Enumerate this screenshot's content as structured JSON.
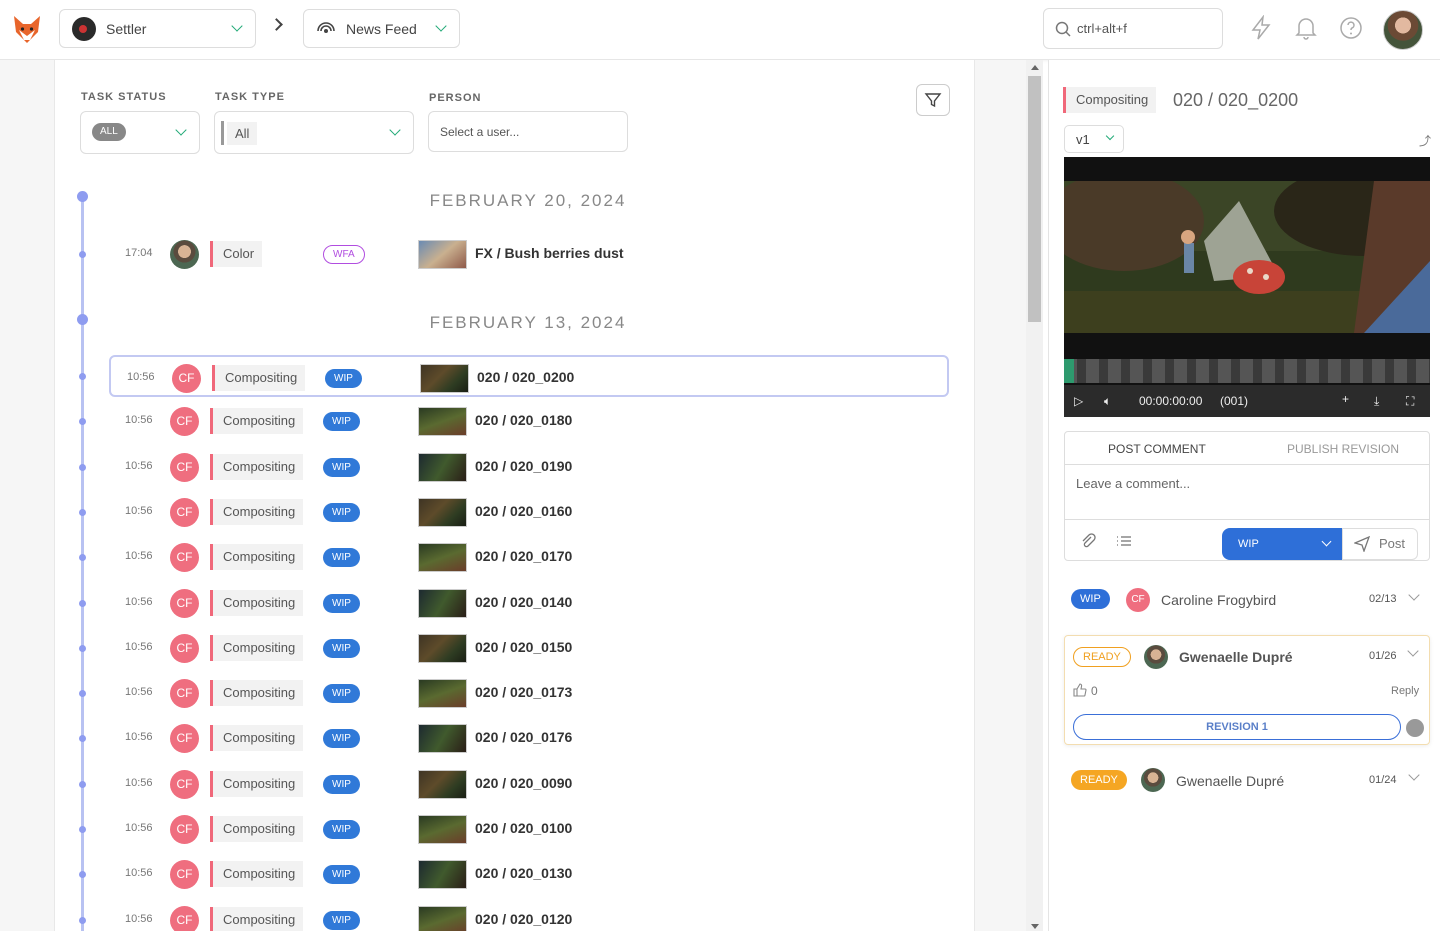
{
  "topbar": {
    "production": "Settler",
    "section": "News Feed",
    "search_placeholder": "ctrl+alt+f"
  },
  "filters": {
    "status_label": "TASK STATUS",
    "status_value": "ALL",
    "type_label": "TASK TYPE",
    "type_value": "All",
    "person_label": "PERSON",
    "person_placeholder": "Select a user..."
  },
  "dates": [
    "FEBRUARY 20, 2024",
    "FEBRUARY 13, 2024"
  ],
  "rows": [
    {
      "time": "17:04",
      "avatar": "",
      "task": "Color",
      "status": "WFA",
      "name": "FX / Bush berries dust"
    },
    {
      "time": "10:56",
      "avatar": "CF",
      "task": "Compositing",
      "status": "WIP",
      "name": "020 / 020_0200"
    },
    {
      "time": "10:56",
      "avatar": "CF",
      "task": "Compositing",
      "status": "WIP",
      "name": "020 / 020_0180"
    },
    {
      "time": "10:56",
      "avatar": "CF",
      "task": "Compositing",
      "status": "WIP",
      "name": "020 / 020_0190"
    },
    {
      "time": "10:56",
      "avatar": "CF",
      "task": "Compositing",
      "status": "WIP",
      "name": "020 / 020_0160"
    },
    {
      "time": "10:56",
      "avatar": "CF",
      "task": "Compositing",
      "status": "WIP",
      "name": "020 / 020_0170"
    },
    {
      "time": "10:56",
      "avatar": "CF",
      "task": "Compositing",
      "status": "WIP",
      "name": "020 / 020_0140"
    },
    {
      "time": "10:56",
      "avatar": "CF",
      "task": "Compositing",
      "status": "WIP",
      "name": "020 / 020_0150"
    },
    {
      "time": "10:56",
      "avatar": "CF",
      "task": "Compositing",
      "status": "WIP",
      "name": "020 / 020_0173"
    },
    {
      "time": "10:56",
      "avatar": "CF",
      "task": "Compositing",
      "status": "WIP",
      "name": "020 / 020_0176"
    },
    {
      "time": "10:56",
      "avatar": "CF",
      "task": "Compositing",
      "status": "WIP",
      "name": "020 / 020_0090"
    },
    {
      "time": "10:56",
      "avatar": "CF",
      "task": "Compositing",
      "status": "WIP",
      "name": "020 / 020_0100"
    },
    {
      "time": "10:56",
      "avatar": "CF",
      "task": "Compositing",
      "status": "WIP",
      "name": "020 / 020_0130"
    },
    {
      "time": "10:56",
      "avatar": "CF",
      "task": "Compositing",
      "status": "WIP",
      "name": "020 / 020_0120"
    }
  ],
  "detail": {
    "task": "Compositing",
    "title": "020 / 020_0200",
    "version": "v1",
    "timecode": "00:00:00:00",
    "frame": "(001)",
    "tab_post": "POST COMMENT",
    "tab_publish": "PUBLISH REVISION",
    "comment_placeholder": "Leave a comment...",
    "status_btn": "WIP",
    "post_btn": "Post"
  },
  "comments": [
    {
      "status": "WIP",
      "avatar": "CF",
      "author": "Caroline Frogybird",
      "date": "02/13"
    },
    {
      "status": "READY",
      "author": "Gwenaelle Dupré",
      "date": "01/26",
      "likes": "0",
      "reply": "Reply",
      "revision": "REVISION 1"
    },
    {
      "status": "READY",
      "author": "Gwenaelle Dupré",
      "date": "01/24"
    }
  ],
  "colors": {
    "accent": "#2e6fd8",
    "task_bar": "#f0687a",
    "timeline": "#8e9cf0",
    "wfa": "#b14de0",
    "ready": "#f5a623"
  }
}
